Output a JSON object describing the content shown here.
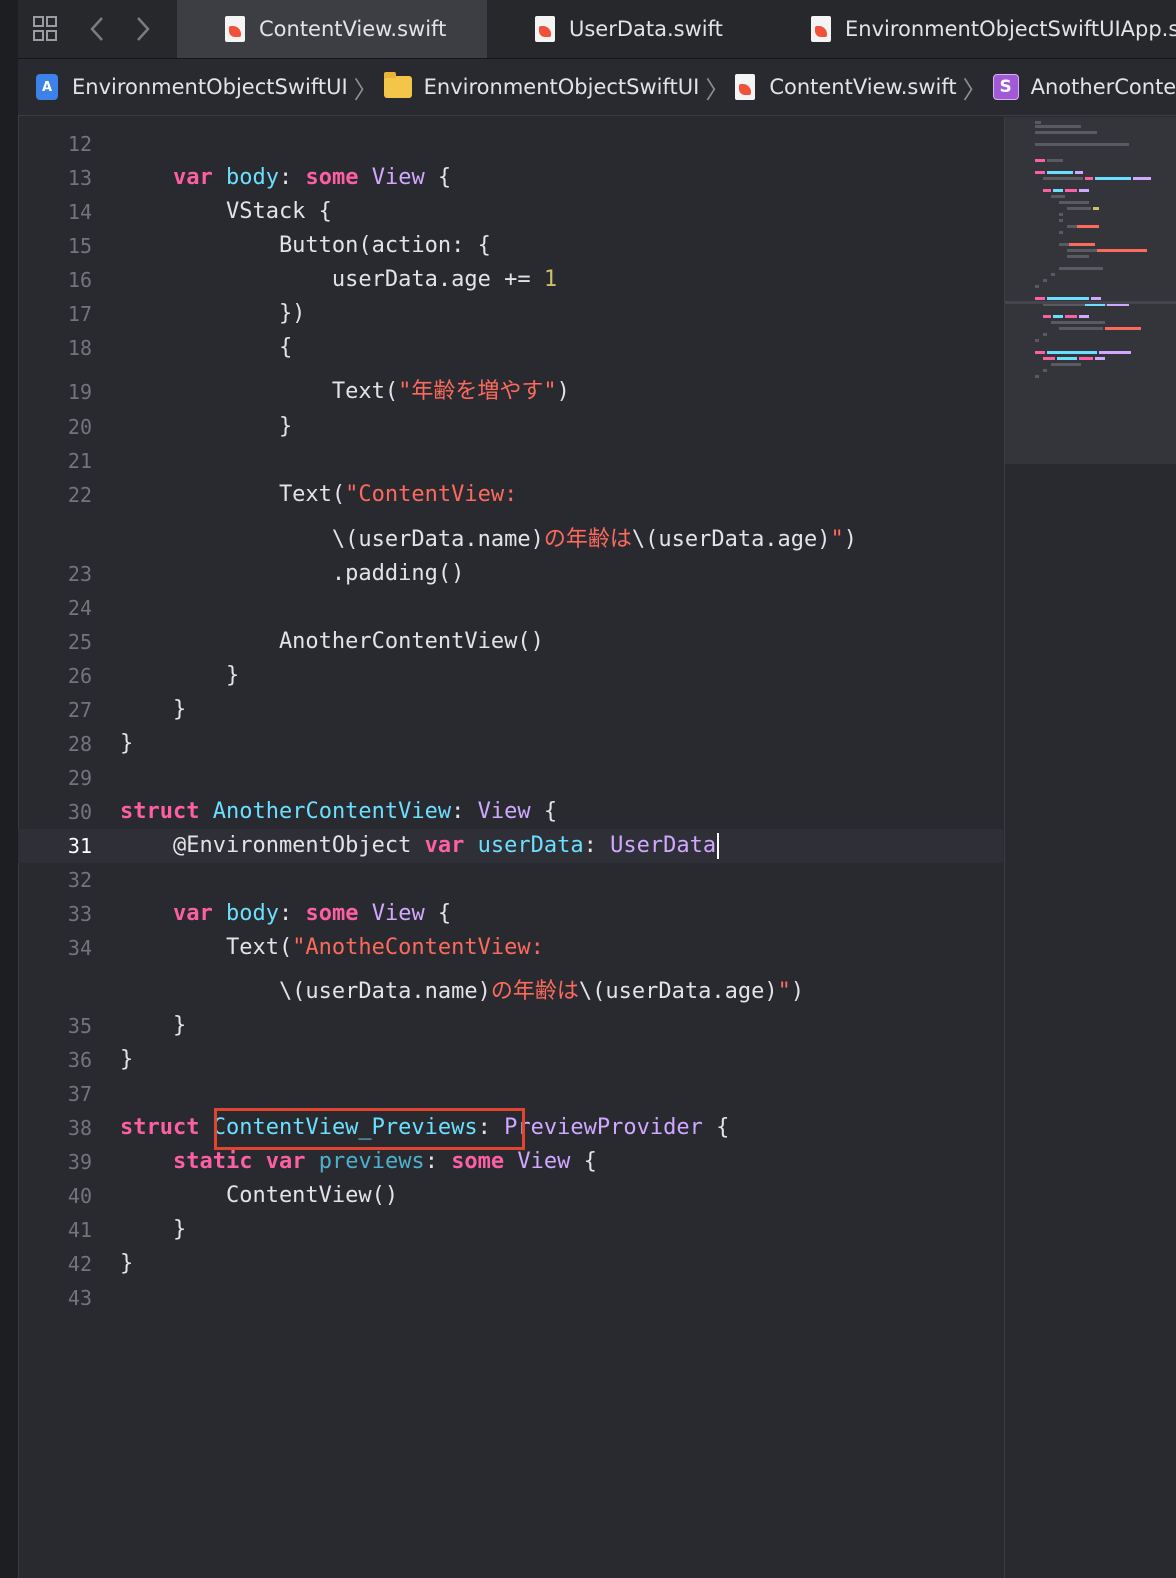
{
  "tabbar": {
    "tabs": [
      {
        "label": "ContentView.swift",
        "active": true
      },
      {
        "label": "UserData.swift",
        "active": false
      },
      {
        "label": "EnvironmentObjectSwiftUIApp.s",
        "active": false
      }
    ]
  },
  "breadcrumb": [
    {
      "label": "EnvironmentObjectSwiftUI",
      "icon": "app-project-icon"
    },
    {
      "label": "EnvironmentObjectSwiftUI",
      "icon": "folder-icon"
    },
    {
      "label": "ContentView.swift",
      "icon": "swift-file-icon"
    },
    {
      "label": "AnotherContentV",
      "icon": "struct-icon",
      "icon_letter": "S"
    }
  ],
  "code_lines": [
    {
      "n": "12",
      "tokens": []
    },
    {
      "n": "13",
      "tokens": [
        [
          "    ",
          ""
        ],
        [
          "var",
          "kw"
        ],
        [
          " ",
          ""
        ],
        [
          "body",
          "dec"
        ],
        [
          ": ",
          ""
        ],
        [
          "some",
          "kw"
        ],
        [
          " ",
          ""
        ],
        [
          "View",
          "ty"
        ],
        [
          " {",
          ""
        ]
      ]
    },
    {
      "n": "14",
      "tokens": [
        [
          "        VStack {",
          ""
        ]
      ]
    },
    {
      "n": "15",
      "tokens": [
        [
          "            Button(action: {",
          ""
        ]
      ]
    },
    {
      "n": "16",
      "tokens": [
        [
          "                userData.age += ",
          ""
        ],
        [
          "1",
          "num"
        ]
      ]
    },
    {
      "n": "17",
      "tokens": [
        [
          "            })",
          ""
        ]
      ]
    },
    {
      "n": "18",
      "tokens": [
        [
          "            {",
          ""
        ]
      ]
    },
    {
      "n": "19",
      "tokens": [
        [
          "                Text(",
          ""
        ],
        [
          "\"年齢を増やす\"",
          "str"
        ],
        [
          ")",
          ""
        ]
      ]
    },
    {
      "n": "20",
      "tokens": [
        [
          "            }",
          ""
        ]
      ]
    },
    {
      "n": "21",
      "tokens": []
    },
    {
      "n": "22",
      "tokens": [
        [
          "            Text(",
          ""
        ],
        [
          "\"ContentView:",
          "str"
        ]
      ]
    },
    {
      "n": "",
      "tokens": [
        [
          "                \\(userData.name)",
          ""
        ],
        [
          "の年齢は",
          "str"
        ],
        [
          "\\(userData.age)",
          ""
        ],
        [
          "\"",
          "str"
        ],
        [
          ")",
          ""
        ]
      ]
    },
    {
      "n": "23",
      "tokens": [
        [
          "                .padding()",
          ""
        ]
      ]
    },
    {
      "n": "24",
      "tokens": []
    },
    {
      "n": "25",
      "tokens": [
        [
          "            AnotherContentView()",
          ""
        ]
      ]
    },
    {
      "n": "26",
      "tokens": [
        [
          "        }",
          ""
        ]
      ]
    },
    {
      "n": "27",
      "tokens": [
        [
          "    }",
          ""
        ]
      ]
    },
    {
      "n": "28",
      "tokens": [
        [
          "}",
          ""
        ]
      ]
    },
    {
      "n": "29",
      "tokens": []
    },
    {
      "n": "30",
      "tokens": [
        [
          "struct",
          "kw"
        ],
        [
          " ",
          ""
        ],
        [
          "AnotherContentView",
          "dec"
        ],
        [
          ": ",
          ""
        ],
        [
          "View",
          "ty"
        ],
        [
          " {",
          ""
        ]
      ]
    },
    {
      "n": "31",
      "current": true,
      "tokens": [
        [
          "    @EnvironmentObject ",
          ""
        ],
        [
          "var",
          "kw"
        ],
        [
          " ",
          ""
        ],
        [
          "userData",
          "dec"
        ],
        [
          ": ",
          ""
        ],
        [
          "UserData",
          "ty"
        ]
      ]
    },
    {
      "n": "32",
      "tokens": []
    },
    {
      "n": "33",
      "tokens": [
        [
          "    ",
          ""
        ],
        [
          "var",
          "kw"
        ],
        [
          " ",
          ""
        ],
        [
          "body",
          "dec"
        ],
        [
          ": ",
          ""
        ],
        [
          "some",
          "kw"
        ],
        [
          " ",
          ""
        ],
        [
          "View",
          "ty"
        ],
        [
          " {",
          ""
        ]
      ]
    },
    {
      "n": "34",
      "tokens": [
        [
          "        Text(",
          ""
        ],
        [
          "\"AnotheContentView:",
          "str"
        ]
      ]
    },
    {
      "n": "",
      "tokens": [
        [
          "            \\(userData.name)",
          ""
        ],
        [
          "の年齢は",
          "str"
        ],
        [
          "\\(userData.age)",
          ""
        ],
        [
          "\"",
          "str"
        ],
        [
          ")",
          ""
        ]
      ]
    },
    {
      "n": "35",
      "tokens": [
        [
          "    }",
          ""
        ]
      ]
    },
    {
      "n": "36",
      "tokens": [
        [
          "}",
          ""
        ]
      ]
    },
    {
      "n": "37",
      "tokens": []
    },
    {
      "n": "38",
      "tokens": [
        [
          "struct",
          "kw"
        ],
        [
          " ",
          ""
        ],
        [
          "ContentView_Previews",
          "dec"
        ],
        [
          ": ",
          ""
        ],
        [
          "PreviewProvider",
          "ty"
        ],
        [
          " {",
          ""
        ]
      ]
    },
    {
      "n": "39",
      "tokens": [
        [
          "    ",
          ""
        ],
        [
          "static",
          "kw"
        ],
        [
          " ",
          ""
        ],
        [
          "var",
          "kw"
        ],
        [
          " ",
          ""
        ],
        [
          "previews",
          "par"
        ],
        [
          ": ",
          ""
        ],
        [
          "some",
          "kw"
        ],
        [
          " ",
          ""
        ],
        [
          "View",
          "ty"
        ],
        [
          " {",
          ""
        ]
      ]
    },
    {
      "n": "40",
      "tokens": [
        [
          "        ContentView()",
          ""
        ]
      ]
    },
    {
      "n": "41",
      "tokens": [
        [
          "    }",
          ""
        ]
      ]
    },
    {
      "n": "42",
      "tokens": [
        [
          "}",
          ""
        ]
      ]
    },
    {
      "n": "43",
      "tokens": []
    }
  ],
  "colors": {
    "keyword": "#fc5fa3",
    "type": "#d0a8ff",
    "declaration": "#6bdfff",
    "string": "#fc6a5d",
    "number": "#d0bf69",
    "highlight_box": "#e2452f"
  },
  "icons": {
    "grid": "related-items-icon",
    "back": "chevron-left-icon",
    "forward": "chevron-right-icon"
  }
}
